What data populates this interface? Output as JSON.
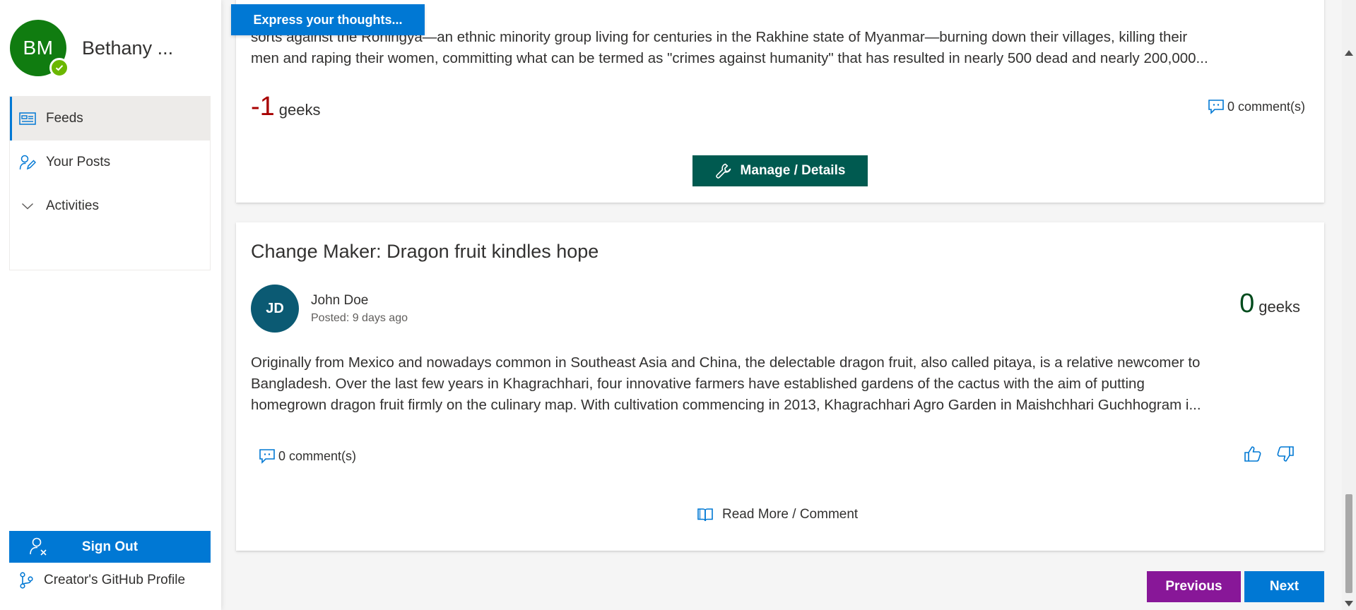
{
  "user": {
    "initials": "BM",
    "name": "Bethany ..."
  },
  "nav": {
    "items": [
      {
        "label": "Feeds",
        "icon": "feeds-icon",
        "active": true
      },
      {
        "label": "Your Posts",
        "icon": "edit-person-icon",
        "active": false
      },
      {
        "label": "Activities",
        "icon": "chevron-down-icon",
        "active": false
      }
    ]
  },
  "sidebar_footer": {
    "sign_out_label": "Sign Out",
    "github_label": "Creator's GitHub Profile"
  },
  "header": {
    "express_label": "Express your thoughts..."
  },
  "post1": {
    "excerpt_lines": [
      "sorts against the Rohingya—an ethnic minority group living for centuries in the Rakhine state of Myanmar—burning down their villages, killing their",
      "men and raping their women, committing what can be termed as \"crimes against humanity\" that has resulted in nearly 500 dead and nearly 200,000..."
    ],
    "geeks_value": "-1",
    "geeks_label": "geeks",
    "comments_label": "0 comment(s)",
    "manage_label": "Manage / Details"
  },
  "post2": {
    "title": "Change Maker: Dragon fruit kindles hope",
    "author_initials": "JD",
    "author_name": "John Doe",
    "posted": "Posted: 9 days ago",
    "geeks_value": "0",
    "geeks_label": "geeks",
    "excerpt_lines": [
      "Originally from Mexico and nowadays common in Southeast Asia and China, the delectable dragon fruit, also called pitaya, is a relative newcomer to",
      "Bangladesh. Over the last few years in Khagrachhari, four innovative farmers have established gardens of the cactus with the aim of putting",
      "homegrown dragon fruit firmly on the culinary map. With cultivation commencing in 2013, Khagrachhari Agro Garden in Maishchhari Guchhogram i..."
    ],
    "comments_label": "0 comment(s)",
    "read_more_label": "Read More / Comment"
  },
  "pagination": {
    "previous_label": "Previous",
    "next_label": "Next"
  },
  "colors": {
    "brand_blue": "#0078d4",
    "negative_red": "#a80000",
    "positive_green": "#004b1c",
    "manage_teal": "#005a50",
    "previous_purple": "#881798",
    "avatar_green": "#107c10",
    "author_avatar": "#0b5a73"
  }
}
